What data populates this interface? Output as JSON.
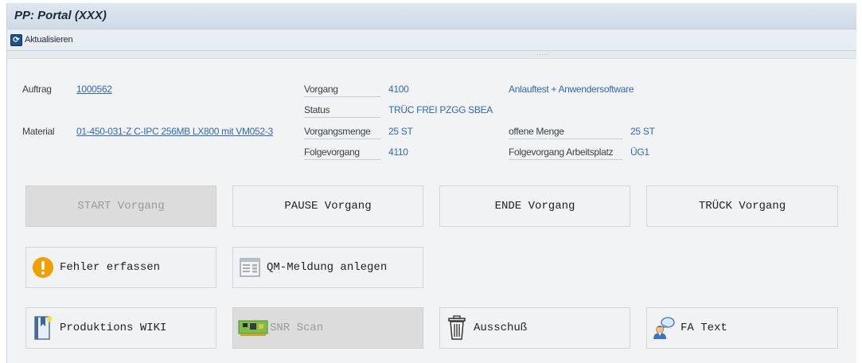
{
  "window": {
    "title": "PP: Portal (XXX)"
  },
  "toolbar": {
    "refresh_label": "Aktualisieren"
  },
  "splitter": {
    "handle": "....."
  },
  "order": {
    "auftrag_label": "Auftrag",
    "auftrag_value": "1000562",
    "material_label": "Material",
    "material_value": "01-450-031-Z C-IPC 256MB LX800 mit VM052-3",
    "vorgang_label": "Vorgang",
    "vorgang_value": "4100",
    "vorgang_text": "Anlauftest + Anwendersoftware",
    "status_label": "Status",
    "status_value": "TRÜC FREI PZGG SBEA",
    "menge_label": "Vorgangsmenge",
    "menge_value": "25 ST",
    "offen_label": "offene Menge",
    "offen_value": "25 ST",
    "folge_label": "Folgevorgang",
    "folge_value": "4110",
    "folge_ap_label": "Folgevorgang Arbeitsplatz",
    "folge_ap_value": "ÜG1"
  },
  "buttons": {
    "start": "START Vorgang",
    "pause": "PAUSE Vorgang",
    "ende": "ENDE Vorgang",
    "trueck": "TRÜCK Vorgang",
    "fehler": "Fehler erfassen",
    "qm": "QM-Meldung anlegen",
    "wiki": "Produktions WIKI",
    "snr": "SNR Scan",
    "ausschuss": "Ausschuß",
    "fatext": "FA Text"
  },
  "icons": {
    "refresh": "refresh-icon",
    "fehler": "warning-icon",
    "qm": "form-document-icon",
    "wiki": "bookmark-book-icon",
    "snr": "circuit-board-icon",
    "ausschuss": "trash-icon",
    "fatext": "user-speech-icon"
  },
  "colors": {
    "accent_blue": "#3169b5",
    "warning_orange": "#f0a000",
    "disabled_bg": "#dcdcdc"
  }
}
